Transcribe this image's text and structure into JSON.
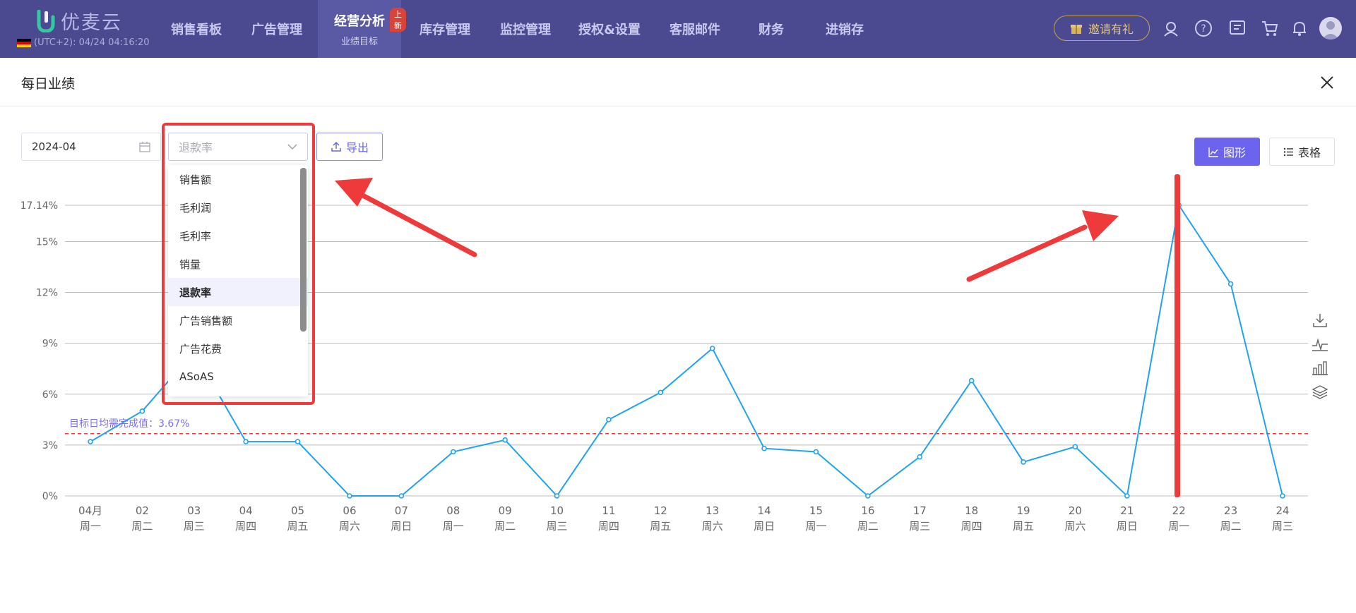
{
  "app": {
    "logo_text": "优麦云",
    "clock": "(UTC+2): 04/24 04:16:20"
  },
  "nav": {
    "items": [
      {
        "label": "销售看板"
      },
      {
        "label": "广告管理"
      },
      {
        "label": "经营分析",
        "sub": "业绩目标",
        "badge": "上新"
      },
      {
        "label": "库存管理"
      },
      {
        "label": "监控管理"
      },
      {
        "label": "授权&设置"
      },
      {
        "label": "客服邮件"
      },
      {
        "label": "财务"
      },
      {
        "label": "进销存"
      }
    ],
    "invite_label": "邀请有礼"
  },
  "modal": {
    "title": "每日业绩"
  },
  "toolbar": {
    "date_value": "2024-04",
    "metric_placeholder": "退款率",
    "export_label": "导出",
    "chart_label": "图形",
    "table_label": "表格"
  },
  "dropdown": {
    "options": [
      "销售额",
      "毛利润",
      "毛利率",
      "销量",
      "退款率",
      "广告销售额",
      "广告花费",
      "ASoAS"
    ],
    "selected_index": 4
  },
  "colors": {
    "nav_bg": "#4b4a91",
    "accent": "#6c63ee",
    "line": "#1fa3f0",
    "target_line": "#ee3a3a",
    "annotation": "#ee3a3a"
  },
  "chart_data": {
    "type": "line",
    "ylim": [
      0,
      17.14
    ],
    "y_ticks": [
      "0%",
      "3%",
      "6%",
      "9%",
      "12%",
      "15%",
      "17.14%"
    ],
    "y_tick_values": [
      0,
      3,
      6,
      9,
      12,
      15,
      17.14
    ],
    "x": [
      "04月",
      "02",
      "03",
      "04",
      "05",
      "06",
      "07",
      "08",
      "09",
      "10",
      "11",
      "12",
      "13",
      "14",
      "15",
      "16",
      "17",
      "18",
      "19",
      "20",
      "21",
      "22",
      "23",
      "24"
    ],
    "x_sub": [
      "周一",
      "周二",
      "周三",
      "周四",
      "周五",
      "周六",
      "周日",
      "周一",
      "周二",
      "周三",
      "周四",
      "周五",
      "周六",
      "周日",
      "周一",
      "周二",
      "周三",
      "周四",
      "周五",
      "周六",
      "周日",
      "周一",
      "周二",
      "周三"
    ],
    "series": [
      {
        "values": [
          3.2,
          5.0,
          8.5,
          3.2,
          3.2,
          0,
          0,
          2.6,
          3.3,
          0,
          4.5,
          6.1,
          8.7,
          2.8,
          2.6,
          0,
          2.3,
          6.8,
          2.0,
          2.9,
          0,
          17.14,
          12.5,
          0
        ]
      }
    ],
    "target": {
      "value": 3.67,
      "label": "目标日均需完成值：3.67%"
    },
    "grid": true
  }
}
